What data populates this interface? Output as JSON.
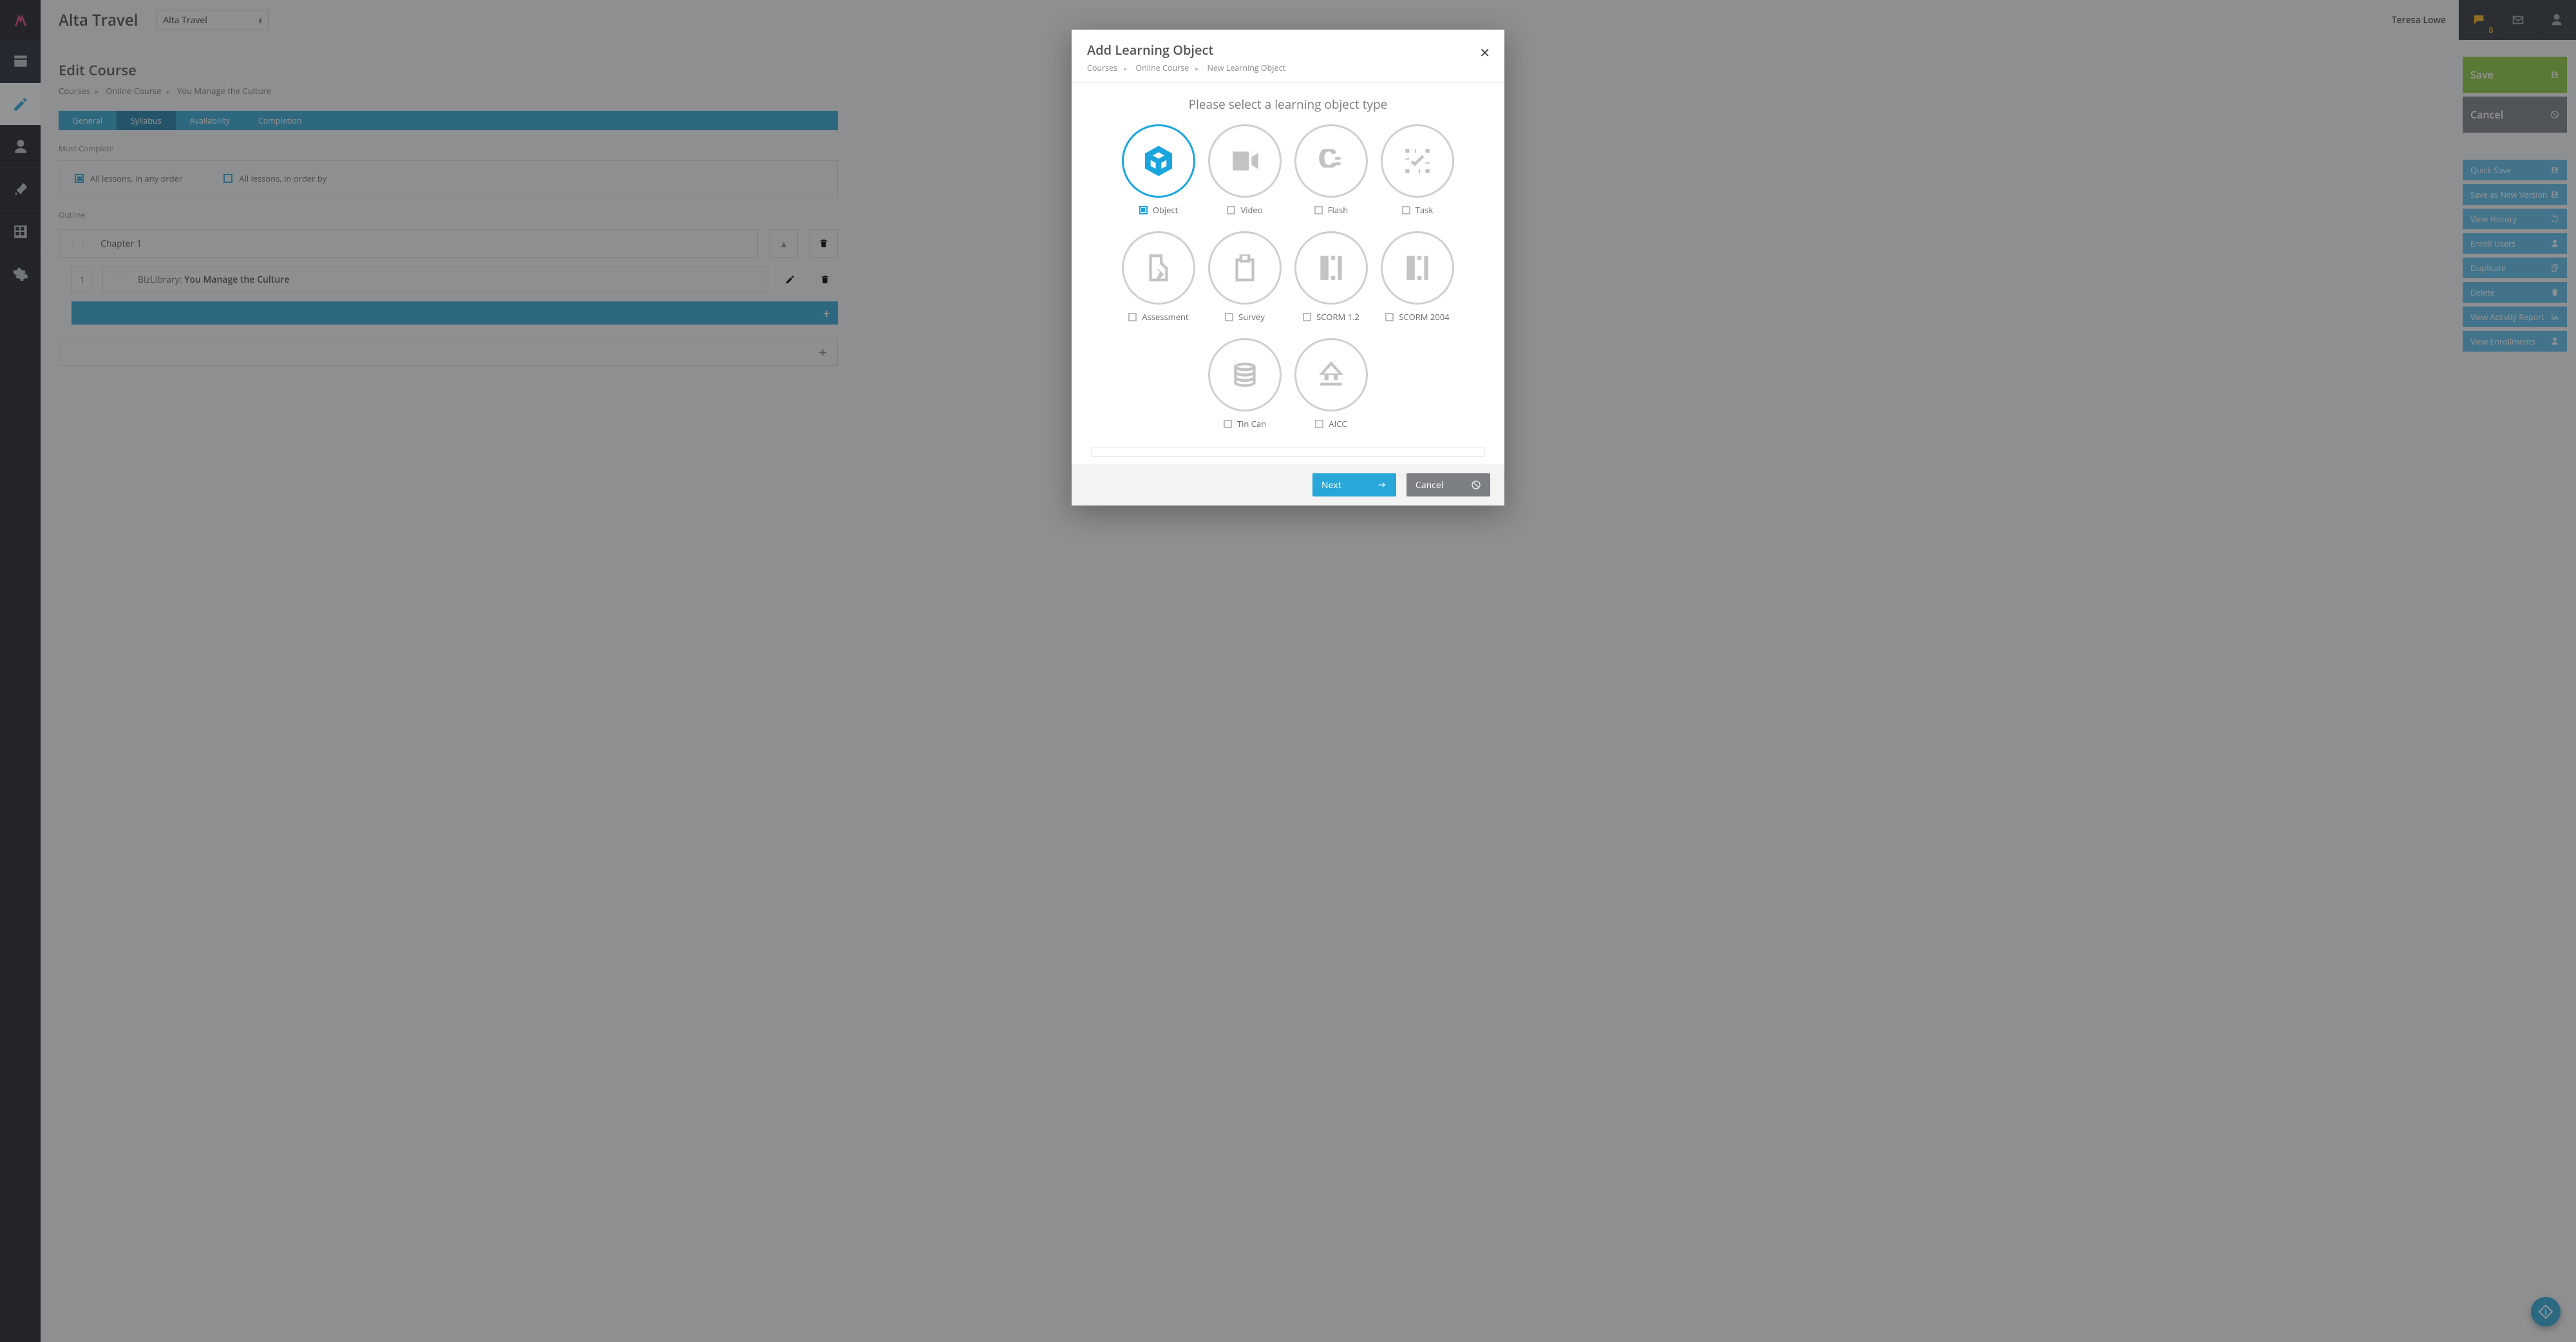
{
  "topbar": {
    "tenant": "Alta Travel",
    "scope_value": "Alta Travel",
    "user": "Teresa Lowe",
    "chat_badge": "8"
  },
  "page": {
    "title": "Edit Course",
    "breadcrumb": [
      "Courses",
      "Online Course",
      "You Manage the Culture"
    ]
  },
  "tabs": {
    "items": [
      "General",
      "Syllabus",
      "Availability",
      "Completion"
    ],
    "active_index": 1
  },
  "mustComplete": {
    "label": "Must Complete",
    "opt1": "All lessons, in any order",
    "opt2": "All lessons, in order by"
  },
  "outline": {
    "label": "Outline",
    "chapter1": "Chapter 1",
    "lesson": {
      "num": "1",
      "prefix": "BizLibrary:",
      "title": "You Manage the Culture"
    }
  },
  "actions": {
    "save": "Save",
    "cancel": "Cancel",
    "small": [
      "Quick Save",
      "Save as New Version",
      "View History",
      "Enroll Users",
      "Duplicate",
      "Delete",
      "View Activity Report",
      "View Enrollments"
    ]
  },
  "modal": {
    "title": "Add Learning Object",
    "breadcrumb": [
      "Courses",
      "Online Course",
      "New Learning Object"
    ],
    "prompt": "Please select a learning object type",
    "types": [
      {
        "label": "Object",
        "icon": "cube",
        "selected": true
      },
      {
        "label": "Video",
        "icon": "video",
        "selected": false
      },
      {
        "label": "Flash",
        "icon": "flash",
        "selected": false
      },
      {
        "label": "Task",
        "icon": "task",
        "selected": false
      },
      {
        "label": "Assessment",
        "icon": "assessment",
        "selected": false
      },
      {
        "label": "Survey",
        "icon": "survey",
        "selected": false
      },
      {
        "label": "SCORM 1.2",
        "icon": "scorm",
        "selected": false
      },
      {
        "label": "SCORM 2004",
        "icon": "scorm",
        "selected": false
      },
      {
        "label": "Tin Can",
        "icon": "tincan",
        "selected": false
      },
      {
        "label": "AICC",
        "icon": "aicc",
        "selected": false
      }
    ],
    "next": "Next",
    "cancel": "Cancel"
  }
}
